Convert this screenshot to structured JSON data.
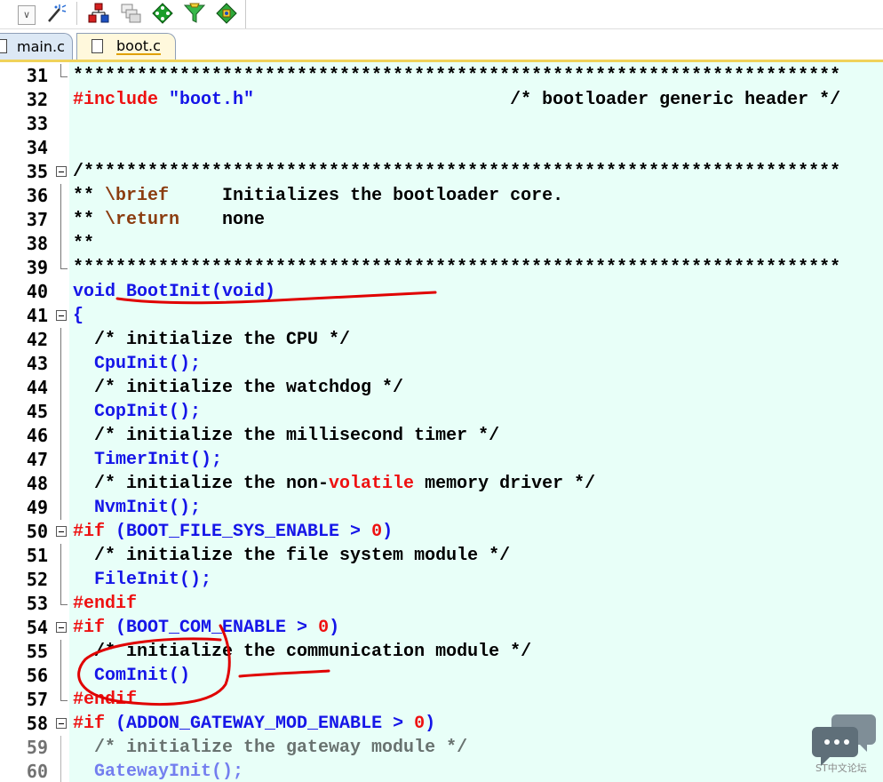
{
  "tabs": [
    {
      "label": "main.c",
      "active": false
    },
    {
      "label": "boot.c",
      "active": true
    }
  ],
  "colors": {
    "editor_bg": "#e8fff8",
    "keyword_red": "#ee1111",
    "identifier_blue": "#1515e8",
    "doc_tag": "#8b3d10",
    "annotation_red": "#e00000",
    "active_tab": "#fff8dc"
  },
  "toolbar": {
    "icons": [
      "dropdown-arrow-icon",
      "magic-wand-icon",
      "red-hierarchy-icon",
      "window-stack-icon",
      "green-diamond-icon",
      "funnel-icon",
      "green-puzzle-icon"
    ]
  },
  "lines": [
    {
      "n": "31",
      "fold": "end",
      "parts": [
        {
          "t": "************************************************************************",
          "c": "black"
        }
      ]
    },
    {
      "n": "32",
      "parts": [
        {
          "t": "#include",
          "c": "red"
        },
        {
          "t": " ",
          "c": "black"
        },
        {
          "t": "\"boot.h\"",
          "c": "blue"
        },
        {
          "t": "                        /* bootloader generic header */",
          "c": "black"
        }
      ]
    },
    {
      "n": "33",
      "parts": []
    },
    {
      "n": "34",
      "parts": []
    },
    {
      "n": "35",
      "fold": "box",
      "parts": [
        {
          "t": "/***********************************************************************",
          "c": "black"
        }
      ]
    },
    {
      "n": "36",
      "fold": "line",
      "parts": [
        {
          "t": "** ",
          "c": "black"
        },
        {
          "t": "\\brief",
          "c": "brown"
        },
        {
          "t": "     Initializes the bootloader core.",
          "c": "black"
        }
      ]
    },
    {
      "n": "37",
      "fold": "line",
      "parts": [
        {
          "t": "** ",
          "c": "black"
        },
        {
          "t": "\\return",
          "c": "brown"
        },
        {
          "t": "    none",
          "c": "black"
        }
      ]
    },
    {
      "n": "38",
      "fold": "line",
      "parts": [
        {
          "t": "**",
          "c": "black"
        }
      ]
    },
    {
      "n": "39",
      "fold": "end",
      "parts": [
        {
          "t": "************************************************************************",
          "c": "black"
        }
      ]
    },
    {
      "n": "40",
      "parts": [
        {
          "t": "void BootInit(void)",
          "c": "blue"
        }
      ]
    },
    {
      "n": "41",
      "fold": "box",
      "parts": [
        {
          "t": "{",
          "c": "blue"
        }
      ]
    },
    {
      "n": "42",
      "fold": "line",
      "parts": [
        {
          "t": "  /* initialize the CPU */",
          "c": "black"
        }
      ]
    },
    {
      "n": "43",
      "fold": "line",
      "parts": [
        {
          "t": "  CpuInit();",
          "c": "blue"
        }
      ]
    },
    {
      "n": "44",
      "fold": "line",
      "parts": [
        {
          "t": "  /* initialize the watchdog */",
          "c": "black"
        }
      ]
    },
    {
      "n": "45",
      "fold": "line",
      "parts": [
        {
          "t": "  CopInit();",
          "c": "blue"
        }
      ]
    },
    {
      "n": "46",
      "fold": "line",
      "parts": [
        {
          "t": "  /* initialize the millisecond timer */",
          "c": "black"
        }
      ]
    },
    {
      "n": "47",
      "fold": "line",
      "parts": [
        {
          "t": "  TimerInit();",
          "c": "blue"
        }
      ]
    },
    {
      "n": "48",
      "fold": "line",
      "parts": [
        {
          "t": "  /* initialize the non-",
          "c": "black"
        },
        {
          "t": "volatile",
          "c": "red"
        },
        {
          "t": " memory driver */",
          "c": "black"
        }
      ]
    },
    {
      "n": "49",
      "fold": "line",
      "parts": [
        {
          "t": "  NvmInit();",
          "c": "blue"
        }
      ]
    },
    {
      "n": "50",
      "fold": "box",
      "parts": [
        {
          "t": "#if",
          "c": "red"
        },
        {
          "t": " (BOOT_FILE_SYS_ENABLE > ",
          "c": "blue"
        },
        {
          "t": "0",
          "c": "red"
        },
        {
          "t": ")",
          "c": "blue"
        }
      ]
    },
    {
      "n": "51",
      "fold": "line",
      "parts": [
        {
          "t": "  /* initialize the file system module */",
          "c": "black"
        }
      ]
    },
    {
      "n": "52",
      "fold": "line",
      "parts": [
        {
          "t": "  FileInit();",
          "c": "blue"
        }
      ]
    },
    {
      "n": "53",
      "fold": "end",
      "parts": [
        {
          "t": "#endif",
          "c": "red"
        }
      ]
    },
    {
      "n": "54",
      "fold": "box",
      "parts": [
        {
          "t": "#if",
          "c": "red"
        },
        {
          "t": " (BOOT_COM_ENABLE > ",
          "c": "blue"
        },
        {
          "t": "0",
          "c": "red"
        },
        {
          "t": ")",
          "c": "blue"
        }
      ]
    },
    {
      "n": "55",
      "fold": "line",
      "parts": [
        {
          "t": "  /* initialize the communication module */",
          "c": "black"
        }
      ]
    },
    {
      "n": "56",
      "fold": "line",
      "parts": [
        {
          "t": "  ComInit()",
          "c": "blue"
        }
      ]
    },
    {
      "n": "57",
      "fold": "end",
      "parts": [
        {
          "t": "#endif",
          "c": "red"
        }
      ]
    },
    {
      "n": "58",
      "fold": "box",
      "parts": [
        {
          "t": "#if",
          "c": "red"
        },
        {
          "t": " (ADDON_GATEWAY_MOD_ENABLE > ",
          "c": "blue"
        },
        {
          "t": "0",
          "c": "red"
        },
        {
          "t": ")",
          "c": "blue"
        }
      ]
    },
    {
      "n": "59",
      "fold": "line",
      "faded": true,
      "parts": [
        {
          "t": "  /* initialize the gateway module */",
          "c": "black"
        }
      ]
    },
    {
      "n": "60",
      "fold": "line",
      "faded": true,
      "parts": [
        {
          "t": "  GatewayInit();",
          "c": "blue"
        }
      ]
    }
  ],
  "watermark": {
    "text": "ST中文论坛"
  }
}
